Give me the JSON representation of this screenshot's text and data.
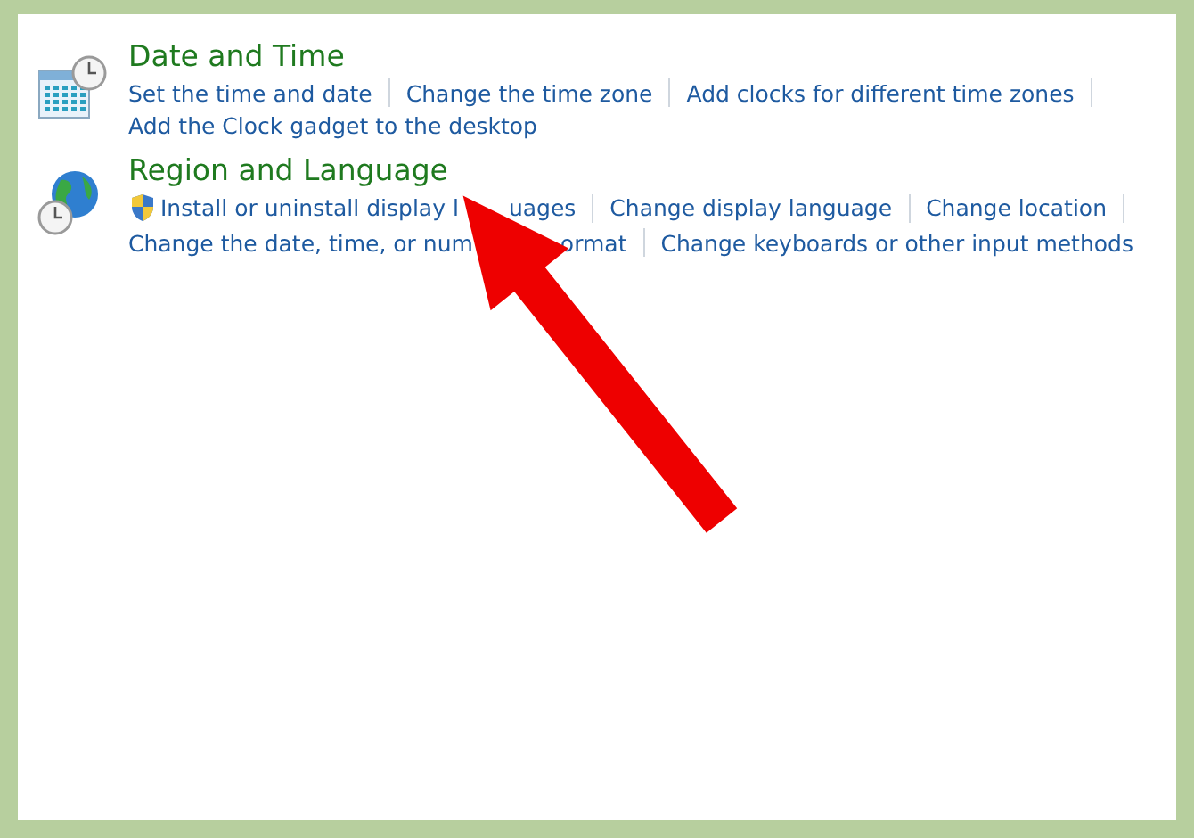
{
  "categories": [
    {
      "kind": "date-time",
      "title": "Date and Time",
      "link_rows": [
        [
          {
            "text": "Set the time and date",
            "shield": false
          },
          {
            "text": "Change the time zone",
            "shield": false
          },
          {
            "text": "Add clocks for different time zones",
            "shield": false
          }
        ],
        [
          {
            "text": "Add the Clock gadget to the desktop",
            "shield": false
          }
        ]
      ]
    },
    {
      "kind": "region",
      "title": "Region and Language",
      "link_rows": [
        [
          {
            "text": "Install or uninstall display l",
            "text_after_arrow": "uages",
            "shield": true
          },
          {
            "text": "Change display language",
            "shield": false
          },
          {
            "text": "Change location",
            "shield": false
          }
        ],
        [
          {
            "text": "Change the date, time, or num",
            "text_after_arrow": "ormat",
            "shield": false
          },
          {
            "text": "Change keyboards or other input methods",
            "shield": false
          }
        ]
      ]
    }
  ]
}
